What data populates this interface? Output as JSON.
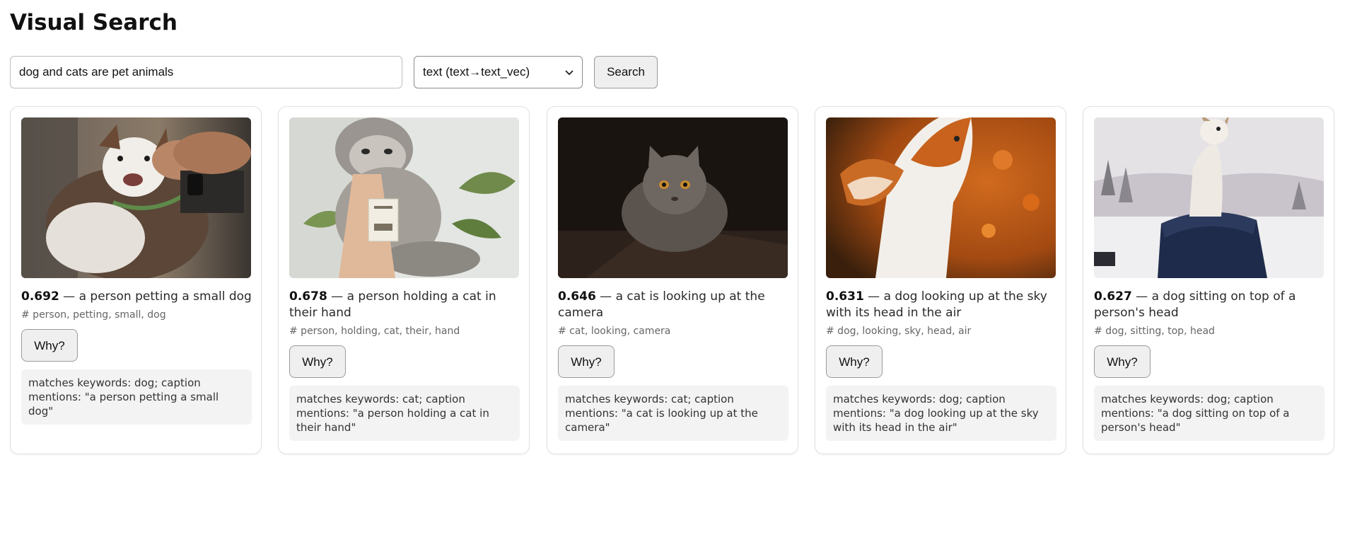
{
  "page": {
    "title": "Visual Search"
  },
  "search": {
    "query_value": "dog and cats are pet animals",
    "mode_selected": "text (text→text_vec)",
    "button_label": "Search"
  },
  "results": [
    {
      "score": "0.692",
      "separator": " — ",
      "caption": "a person petting a small dog",
      "tags": "# person, petting, small, dog",
      "why_label": "Why?",
      "explanation": "matches keywords: dog; caption mentions: \"a person petting a small dog\""
    },
    {
      "score": "0.678",
      "separator": " — ",
      "caption": "a person holding a cat in their hand",
      "tags": "# person, holding, cat, their, hand",
      "why_label": "Why?",
      "explanation": "matches keywords: cat; caption mentions: \"a person holding a cat in their hand\""
    },
    {
      "score": "0.646",
      "separator": " — ",
      "caption": "a cat is looking up at the camera",
      "tags": "# cat, looking, camera",
      "why_label": "Why?",
      "explanation": "matches keywords: cat; caption mentions: \"a cat is looking up at the camera\""
    },
    {
      "score": "0.631",
      "separator": " — ",
      "caption": "a dog looking up at the sky with its head in the air",
      "tags": "# dog, looking, sky, head, air",
      "why_label": "Why?",
      "explanation": "matches keywords: dog; caption mentions: \"a dog looking up at the sky with its head in the air\""
    },
    {
      "score": "0.627",
      "separator": " — ",
      "caption": "a dog sitting on top of a person's head",
      "tags": "# dog, sitting, top, head",
      "why_label": "Why?",
      "explanation": "matches keywords: dog; caption mentions: \"a dog sitting on top of a person's head\""
    }
  ]
}
